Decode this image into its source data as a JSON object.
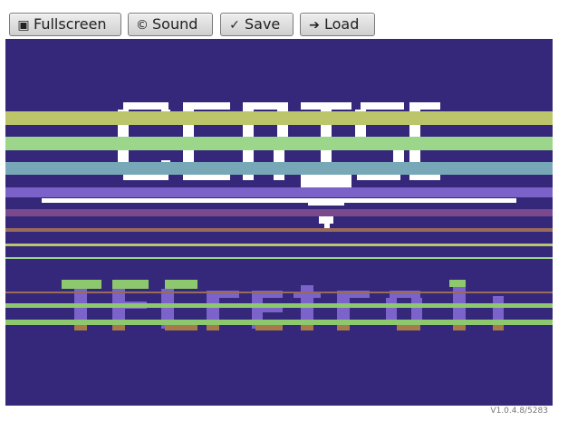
{
  "toolbar": {
    "fullscreen": {
      "icon": "fullscreen-icon",
      "glyph": "▣",
      "label": "Fullscreen"
    },
    "sound": {
      "icon": "sound-icon",
      "glyph": "©",
      "label": "Sound"
    },
    "save": {
      "icon": "save-icon",
      "glyph": "✓",
      "label": "Save"
    },
    "load": {
      "icon": "load-icon",
      "glyph": "➔",
      "label": "Load"
    }
  },
  "screen": {
    "background_color": "#35287a",
    "title_upper": "CERT SE",
    "title_lower": "TFCretroli",
    "colors": {
      "white": "#ffffff",
      "yellow_green": "#bcc56a",
      "light_green": "#9bd68a",
      "cyan": "#78a8b8",
      "purple": "#7a62c8",
      "magenta": "#7a4a8c",
      "brown": "#9a6a5a",
      "green": "#8ec86e",
      "orange": "#a87a4a",
      "lilac": "#7b63c9"
    }
  },
  "version": "V1.0.4.8/5283"
}
